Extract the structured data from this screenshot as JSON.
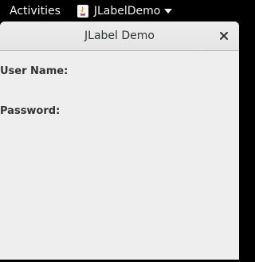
{
  "topbar": {
    "activities_label": "Activities",
    "app_name": "JLabelDemo",
    "app_icon": "java-icon"
  },
  "window": {
    "title": "JLabel Demo",
    "close_icon": "close-icon"
  },
  "form": {
    "user_name_label": "User Name:",
    "password_label": "Password:"
  },
  "colors": {
    "topbar_bg": "#000000",
    "window_bg": "#eeeeee",
    "text": "#333333"
  }
}
